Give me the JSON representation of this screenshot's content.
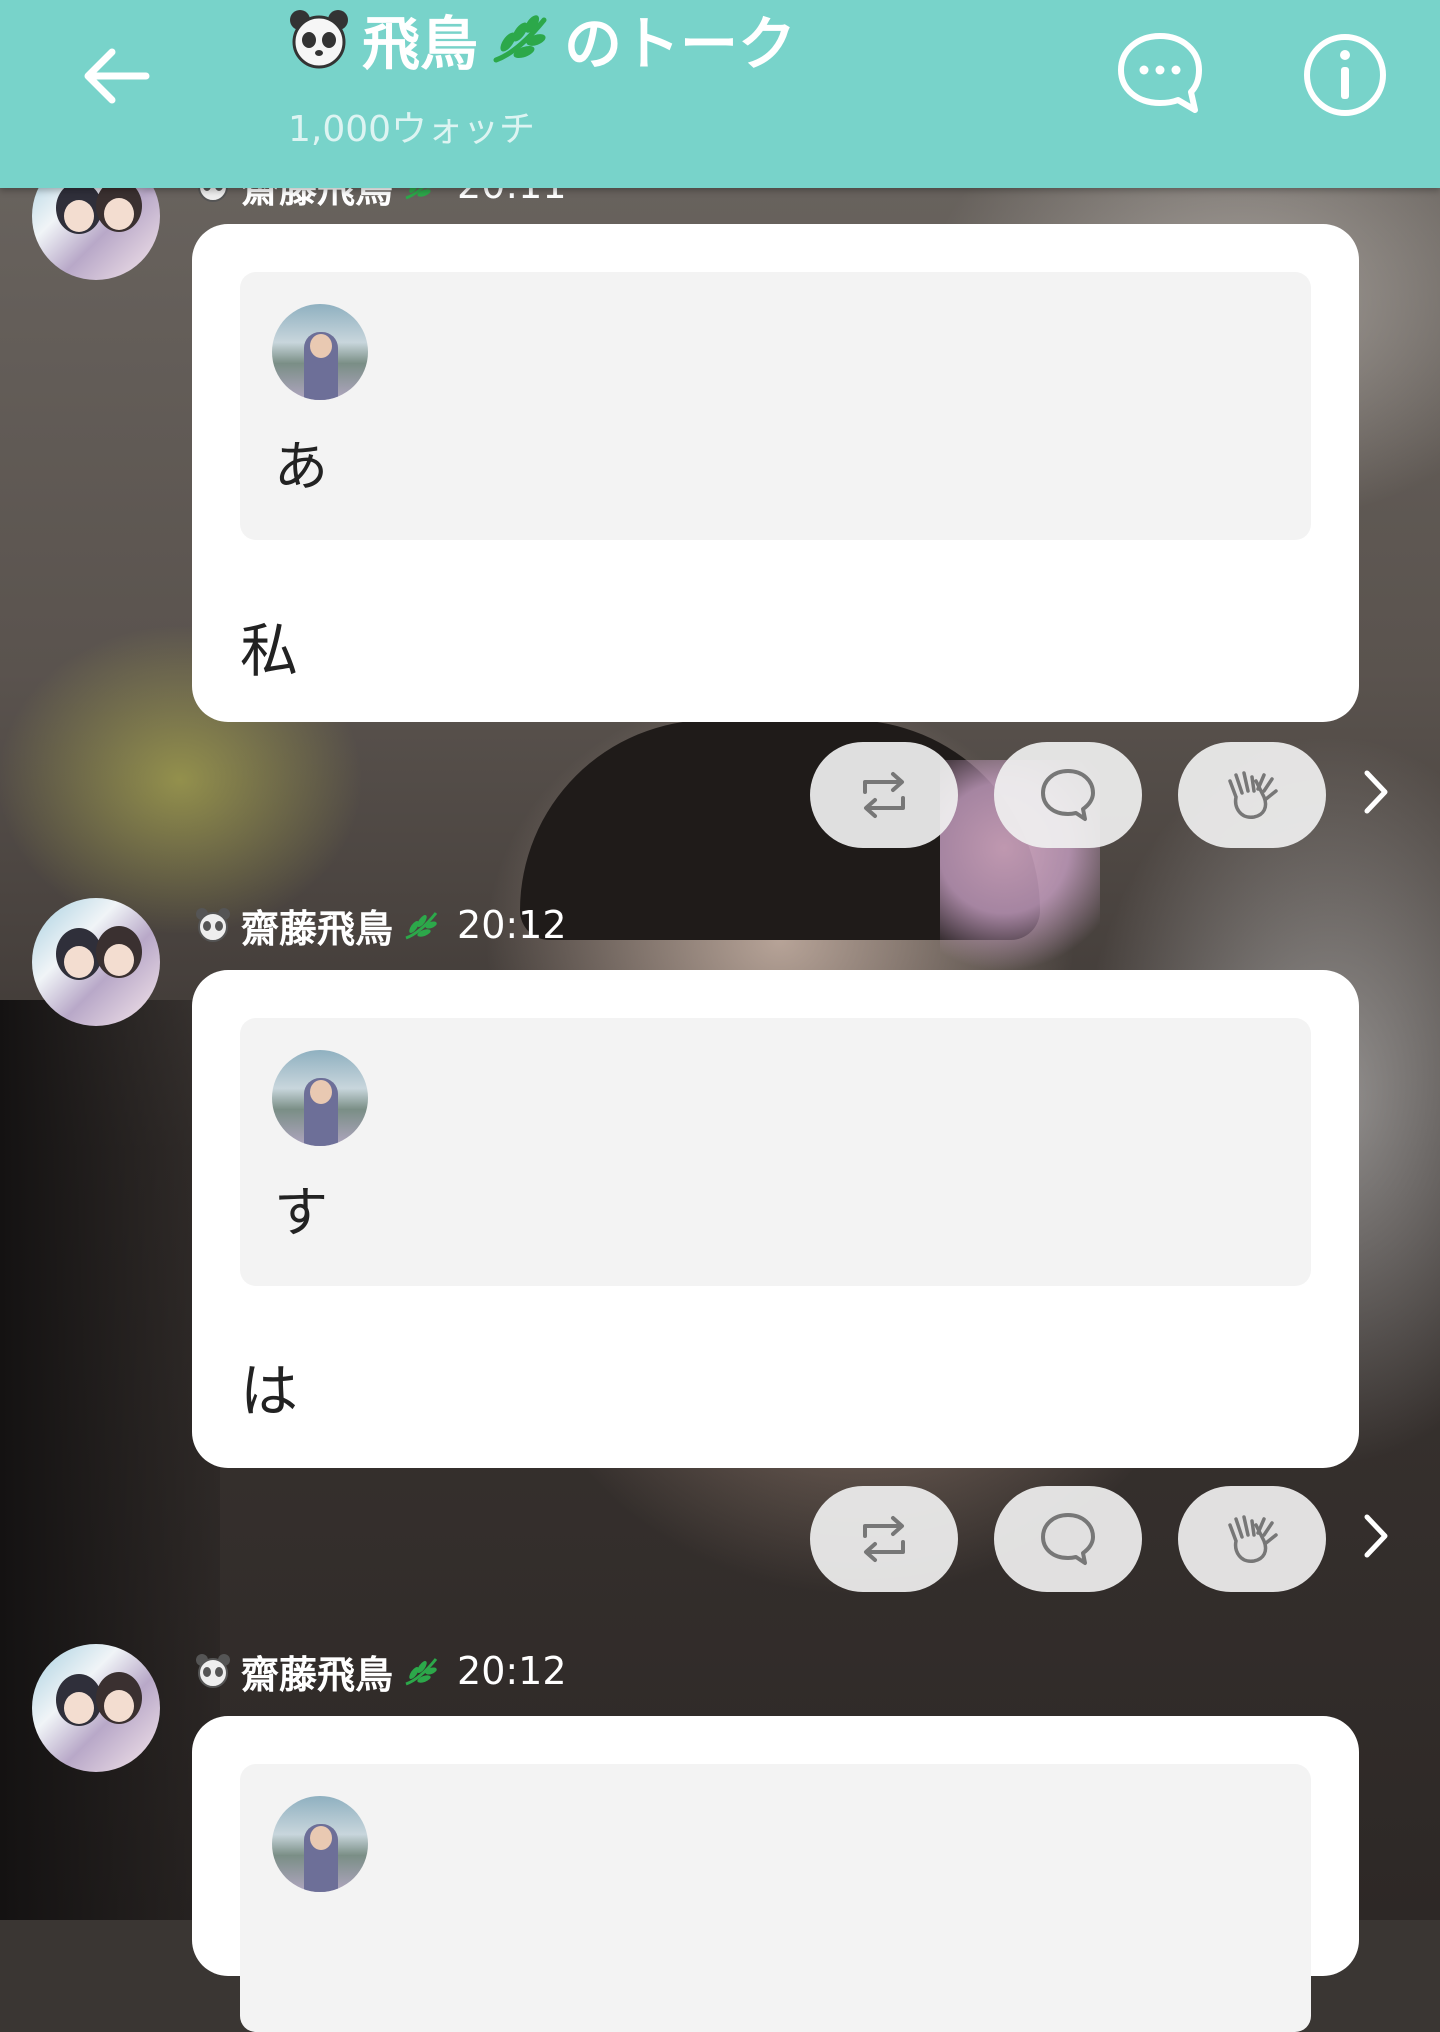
{
  "header": {
    "title_name": "飛鳥",
    "title_suffix": "のトーク",
    "subtitle": "1,000ウォッチ",
    "back_icon": "arrow-left-icon",
    "chat_icon": "speech-bubble-dots-icon",
    "info_icon": "info-icon",
    "background_color": "#78d3ca"
  },
  "messages": [
    {
      "sender": "齋藤飛鳥",
      "time": "20:11",
      "quote_text": "あ",
      "body_text": "私"
    },
    {
      "sender": "齋藤飛鳥",
      "time": "20:12",
      "quote_text": "す",
      "body_text": "は"
    },
    {
      "sender": "齋藤飛鳥",
      "time": "20:12",
      "quote_text": "",
      "body_text": ""
    }
  ],
  "actions": {
    "share_icon": "repost-icon",
    "comment_icon": "comment-bubble-icon",
    "clap_icon": "clap-hands-icon",
    "more_icon": "chevron-right-icon"
  },
  "colors": {
    "leaf_green": "#2ca84a",
    "card_background": "#ffffff",
    "quote_background": "#f3f3f3"
  }
}
